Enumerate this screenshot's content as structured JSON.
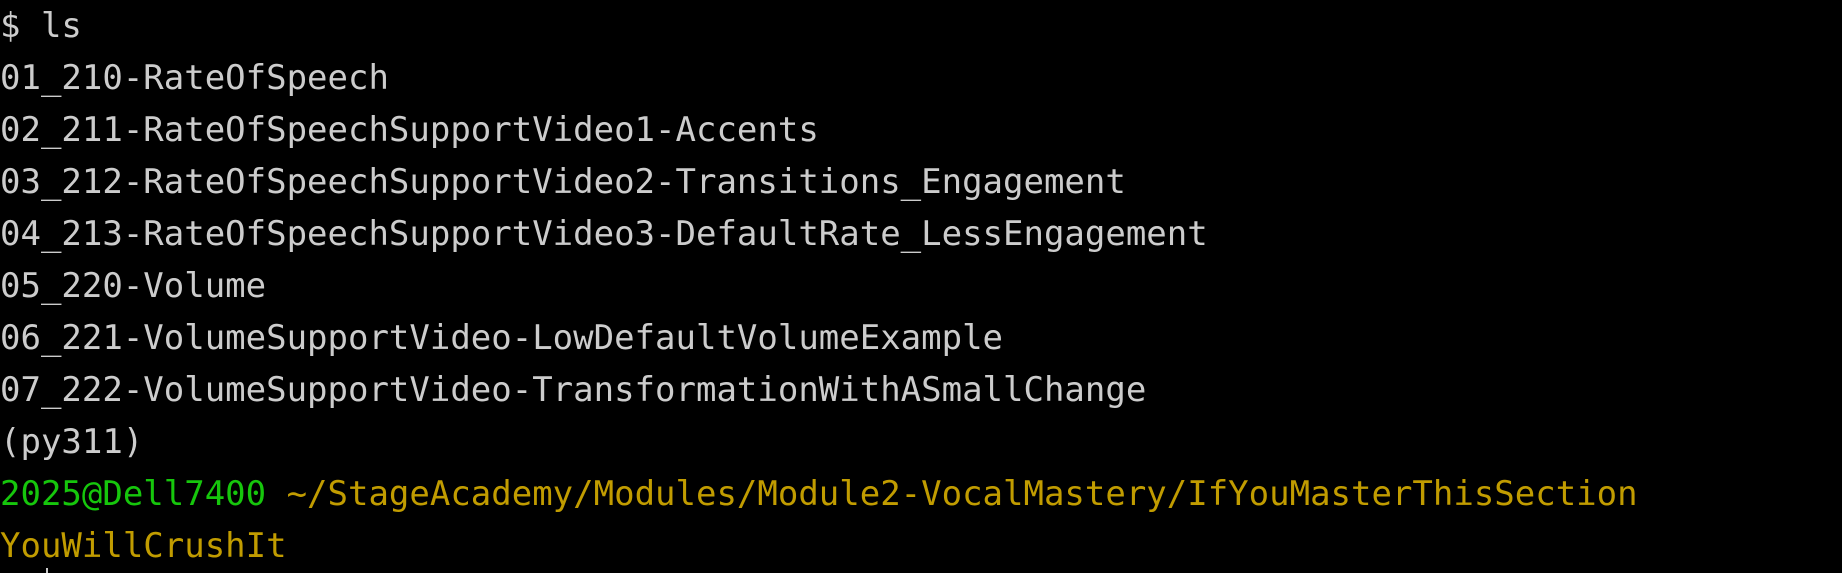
{
  "terminal": {
    "command_line": "$ ls",
    "listing": [
      "01_210-RateOfSpeech",
      "02_211-RateOfSpeechSupportVideo1-Accents",
      "03_212-RateOfSpeechSupportVideo2-Transitions_Engagement",
      "04_213-RateOfSpeechSupportVideo3-DefaultRate_LessEngagement",
      "05_220-Volume",
      "06_221-VolumeSupportVideo-LowDefaultVolumeExample",
      "07_222-VolumeSupportVideo-TransformationWithASmallChange"
    ],
    "env": "(py311)",
    "prompt_user": "2025@Dell7400",
    "prompt_path_line1": " ~/StageAcademy/Modules/Module2-VocalMastery/IfYouMasterThisSection",
    "prompt_path_line2": "YouWillCrushIt"
  },
  "colors": {
    "background": "#000000",
    "text": "#cccccc",
    "user": "#16c60c",
    "path": "#c19c00"
  }
}
